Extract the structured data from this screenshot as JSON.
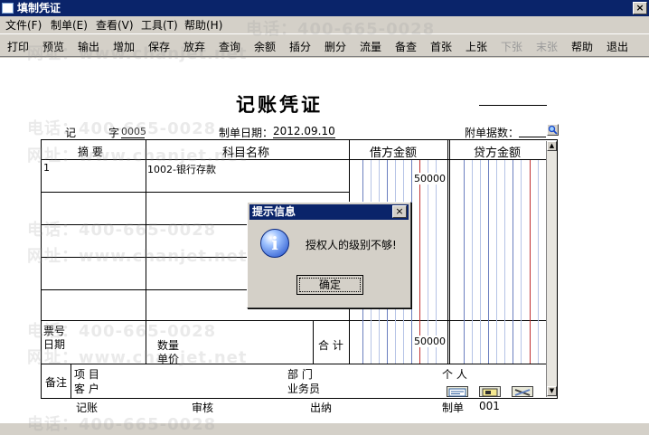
{
  "window": {
    "title": "填制凭证",
    "close_glyph": "×"
  },
  "menu": [
    "文件(F)",
    "制单(E)",
    "查看(V)",
    "工具(T)",
    "帮助(H)"
  ],
  "toolbar": {
    "items": [
      "打印",
      "预览",
      "输出",
      "增加",
      "保存",
      "放弃",
      "查询",
      "余额",
      "插分",
      "删分",
      "流量",
      "备查",
      "首张",
      "上张",
      "下张",
      "末张",
      "帮助",
      "退出"
    ],
    "disabled": [
      "下张",
      "末张"
    ]
  },
  "voucher": {
    "title": "记账凭证",
    "type_char": "记",
    "zi_label": "字",
    "number": "0005",
    "date_label": "制单日期：",
    "date": "2012.09.10",
    "attach_label": "附单据数：",
    "columns": {
      "summary": "摘  要",
      "account": "科目名称",
      "debit": "借方金额",
      "credit": "贷方金额"
    },
    "rows": [
      {
        "summary": "1",
        "account": "1002-银行存款",
        "debit": "50000",
        "credit": ""
      }
    ],
    "bill_no_label": "票号",
    "date_label2": "日期",
    "qty_label": "数量",
    "price_label": "单价",
    "total_label": "合 计",
    "total_debit": "50000",
    "remark_label": "备注",
    "project_label": "项  目",
    "dept_label": "部  门",
    "person_label": "个  人",
    "customer_label": "客  户",
    "salesman_label": "业务员"
  },
  "footer": {
    "bookkeeper_label": "记账",
    "audit_label": "审核",
    "cashier_label": "出纳",
    "maker_label": "制单",
    "maker": "001"
  },
  "dialog": {
    "title": "提示信息",
    "close_glyph": "×",
    "message": "授权人的级别不够!",
    "ok": "确定",
    "icon": "info-icon"
  },
  "watermark": {
    "phone": "电话：400-665-0028",
    "url": "网址：www.chanjet.net"
  },
  "scroll": {
    "up": "▲",
    "down": "▼"
  }
}
